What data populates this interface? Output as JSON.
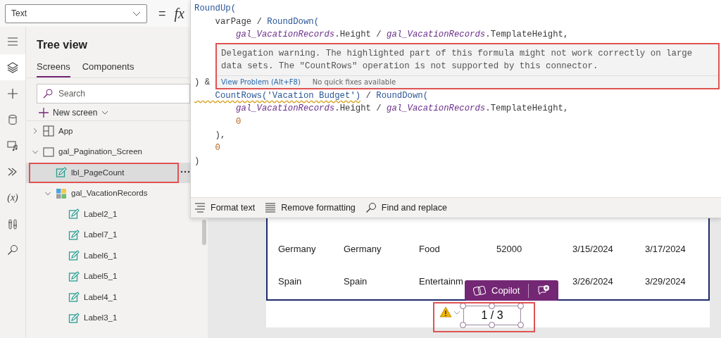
{
  "property_selector": {
    "value": "Text"
  },
  "formula_bar": {
    "equals": "=",
    "fx": "fx"
  },
  "rail": [
    {
      "kind": "menu",
      "selected": false
    },
    {
      "kind": "layers",
      "selected": true
    },
    {
      "kind": "plus",
      "selected": false
    },
    {
      "kind": "data",
      "selected": false
    },
    {
      "kind": "media",
      "selected": false
    },
    {
      "kind": "power",
      "selected": false
    },
    {
      "kind": "variables",
      "glyph": "(x)",
      "selected": false
    },
    {
      "kind": "tools",
      "selected": false
    },
    {
      "kind": "search",
      "selected": false
    }
  ],
  "tree_view": {
    "title": "Tree view",
    "tabs": [
      {
        "label": "Screens",
        "selected": true
      },
      {
        "label": "Components",
        "selected": false
      }
    ],
    "search": {
      "placeholder": "Search"
    },
    "new_screen": "New screen",
    "items": [
      {
        "kind": "app",
        "label": "App",
        "expanded": false,
        "selected": false
      },
      {
        "kind": "screen",
        "label": "gal_Pagination_Screen",
        "expanded": true,
        "selected": false,
        "children": [
          {
            "kind": "label",
            "label": "lbl_PageCount",
            "selected": true
          },
          {
            "kind": "gallery",
            "label": "gal_VacationRecords",
            "expanded": true,
            "selected": false,
            "children": [
              {
                "kind": "label",
                "label": "Label2_1",
                "selected": false
              },
              {
                "kind": "label",
                "label": "Label7_1",
                "selected": false
              },
              {
                "kind": "label",
                "label": "Label6_1",
                "selected": false
              },
              {
                "kind": "label",
                "label": "Label5_1",
                "selected": false
              },
              {
                "kind": "label",
                "label": "Label4_1",
                "selected": false
              },
              {
                "kind": "label",
                "label": "Label3_1",
                "selected": false
              }
            ]
          }
        ]
      }
    ]
  },
  "formula_editor": {
    "lines_before": [
      [
        {
          "kind": "fn",
          "text": "RoundUp("
        }
      ],
      [
        {
          "kind": "plain",
          "text": "    varPage / "
        },
        {
          "kind": "fn",
          "text": "RoundDown("
        }
      ],
      [
        {
          "kind": "control",
          "text": "        gal_VacationRecords"
        },
        {
          "kind": "plain",
          "text": ".Height / "
        },
        {
          "kind": "control",
          "text": "gal_VacationRecords"
        },
        {
          "kind": "plain",
          "text": ".TemplateHeight,"
        }
      ]
    ],
    "line_beside_warning": [
      {
        "kind": "plain",
        "text": ") &"
      }
    ],
    "warning": {
      "message": "Delegation warning. The highlighted part of this formula might not work correctly on large data sets. The \"CountRows\" operation is not supported by this connector.",
      "link": "View Problem (Alt+F8)",
      "note": "No quick fixes available"
    },
    "lines_after": [
      [
        {
          "kind": "fn",
          "text": "    CountRows('Vacation Budget')",
          "flagged": true
        },
        {
          "kind": "plain",
          "text": " / "
        },
        {
          "kind": "fn",
          "text": "RoundDown("
        }
      ],
      [
        {
          "kind": "control",
          "text": "        gal_VacationRecords"
        },
        {
          "kind": "plain",
          "text": ".Height / "
        },
        {
          "kind": "control",
          "text": "gal_VacationRecords"
        },
        {
          "kind": "plain",
          "text": ".TemplateHeight,"
        }
      ],
      [
        {
          "kind": "number",
          "text": "        0"
        }
      ],
      [
        {
          "kind": "plain",
          "text": "    ),"
        }
      ],
      [
        {
          "kind": "number",
          "text": "    0"
        }
      ],
      [
        {
          "kind": "plain",
          "text": ")"
        }
      ]
    ],
    "toolbar": [
      {
        "kind": "format",
        "label": "Format text"
      },
      {
        "kind": "remove",
        "label": "Remove formatting"
      },
      {
        "kind": "find",
        "label": "Find and replace"
      }
    ]
  },
  "gallery": {
    "rows": [
      [
        "Germany",
        "Germany",
        "Food",
        "52000",
        "3/15/2024",
        "3/17/2024"
      ],
      [
        "Spain",
        "Spain",
        "Entertainm",
        null,
        "3/26/2024",
        "3/29/2024"
      ]
    ]
  },
  "copilot": {
    "label": "Copilot"
  },
  "page_label": {
    "text": "1 / 3",
    "warning": true
  }
}
